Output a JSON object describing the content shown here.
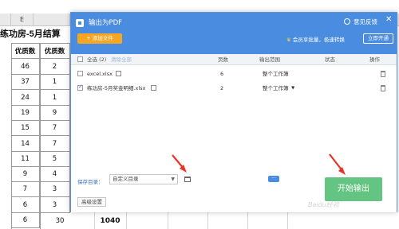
{
  "sheet": {
    "col_e_header": "E",
    "title": "练功房-5月结算",
    "header_a": "优质数",
    "header_b": "优质数",
    "col1": [
      "46",
      "37",
      "24",
      "19",
      "15",
      "14",
      "11",
      "9",
      "7",
      "6",
      "6"
    ],
    "col2": [
      "2",
      "1",
      "1",
      "9",
      "7",
      "7",
      "5",
      "4",
      "3",
      "3"
    ],
    "total_left": "30",
    "total": "1040"
  },
  "dialog": {
    "title": "输出为PDF",
    "feedback": "意见反馈",
    "close": "✕",
    "add_file": "+ 添加文件",
    "promo": "会员享批量，极速转换",
    "activate": "立即开通",
    "columns": {
      "select_all": "全选 (2)",
      "clear_all": "清除全部",
      "pages": "页数",
      "range": "输出范围",
      "status": "状态",
      "actions": "操作"
    },
    "files": [
      {
        "name": "excel.xlsx",
        "pages": "6",
        "range": "整个工作簿",
        "checked": false,
        "dropdown": false
      },
      {
        "name": "练功房-5月奖金明细.xlsx",
        "pages": "2",
        "range": "整个工作簿",
        "checked": true,
        "dropdown": true
      }
    ],
    "save_dir_label": "保存目录：",
    "save_dir_value": "自定义目录",
    "more": "···",
    "advanced": "高级设置",
    "start": "开始输出"
  },
  "watermark": "Baidu经验",
  "colors": {
    "titlebar": "#4a8ce0",
    "add_file": "#f7a623",
    "start_button": "#64c482",
    "arrow": "#e8322a"
  }
}
